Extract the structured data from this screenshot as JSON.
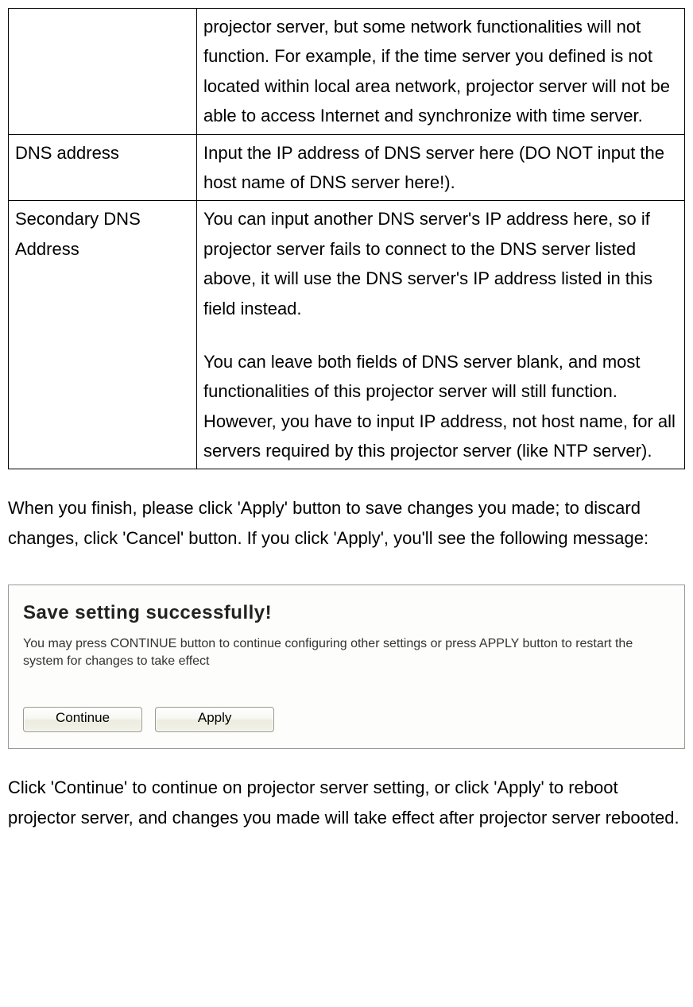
{
  "table": {
    "rows": [
      {
        "label": "",
        "desc": "projector server, but some network functionalities will not function. For example, if the time server you defined is not located within local area network, projector server will not be able to access Internet and synchronize with time server."
      },
      {
        "label": "DNS address",
        "desc": "Input the IP address of DNS server here (DO NOT input the host name of DNS server here!)."
      },
      {
        "label": "Secondary DNS Address",
        "desc_p1": "You can input another DNS server's IP address here, so if projector server fails to connect to the DNS server listed above, it will use the DNS server's IP address listed in this field instead.",
        "desc_p2": "You can leave both fields of DNS server blank, and most functionalities of this projector server will still function. However, you have to input IP address, not host name, for all servers required by this projector server (like NTP server)."
      }
    ]
  },
  "paragraph1": "When you finish, please click 'Apply' button to save changes you made; to discard changes, click 'Cancel' button. If you click 'Apply', you'll see the following message:",
  "dialog": {
    "title": "Save setting successfully!",
    "text": "You may press CONTINUE button to continue configuring other settings or press APPLY button to restart the system for changes to take effect",
    "continue_label": "Continue",
    "apply_label": "Apply"
  },
  "paragraph2": "Click 'Continue' to continue on projector server setting, or click 'Apply' to reboot projector server, and changes you made will take effect after projector server rebooted."
}
